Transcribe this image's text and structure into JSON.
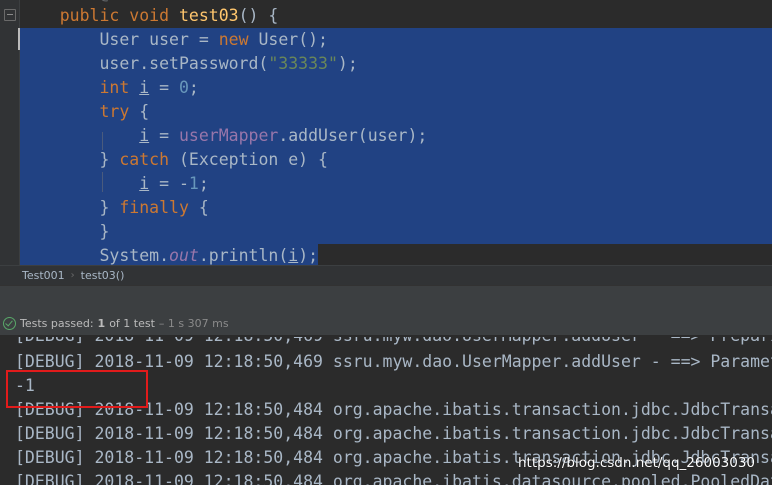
{
  "editor": {
    "lines": [
      {
        "indent": "    ",
        "kw1": "public void ",
        "fn": "test03",
        "rest": "() {"
      },
      {
        "indent": "        ",
        "t1": "User user = ",
        "kw": "new ",
        "t2": "User();"
      },
      {
        "indent": "        ",
        "t1": "user.setPassword(",
        "str": "\"33333\"",
        "t2": ");"
      },
      {
        "indent": "        ",
        "kw": "int ",
        "var": "i",
        "t1": " = ",
        "num": "0",
        "t2": ";"
      },
      {
        "indent": "        ",
        "kw": "try ",
        "t1": "{"
      },
      {
        "indent": "            ",
        "var": "i",
        "t1": " = ",
        "fld": "userMapper",
        "t2": ".addUser(user);"
      },
      {
        "indent": "        ",
        "t1": "} ",
        "kw": "catch ",
        "t2": "(Exception e) {"
      },
      {
        "indent": "            ",
        "var": "i",
        "t1": " = -",
        "num": "1",
        "t2": ";"
      },
      {
        "indent": "        ",
        "t1": "} ",
        "kw": "finally ",
        "t2": "{"
      },
      {
        "indent": "        ",
        "t1": "}"
      },
      {
        "indent": "        ",
        "t1": "System.",
        "it": "out",
        "t2": ".println(",
        "var": "i",
        "t3": ");"
      }
    ]
  },
  "breadcrumb": {
    "class": "Test001",
    "method": "test03()"
  },
  "status": {
    "label": "Tests passed:",
    "passed": "1",
    "of_text": "of 1 test",
    "time": "– 1 s 307 ms"
  },
  "console": {
    "lines": [
      "[DEBUG] 2018-11-09 12:18:50,469 ssru.myw.dao.UserMapper.addUser - ==> Parameters",
      "-1",
      "[DEBUG] 2018-11-09 12:18:50,484 org.apache.ibatis.transaction.jdbc.JdbcTransaction",
      "[DEBUG] 2018-11-09 12:18:50,484 org.apache.ibatis.transaction.jdbc.JdbcTransaction",
      "[DEBUG] 2018-11-09 12:18:50,484 org.apache.ibatis.transaction.jdbc.JdbcTransaction",
      "[DEBUG] 2018-11-09 12:18:50,484 org.apache.ibatis.datasource.pooled.PooledDataSource"
    ],
    "partial_top": "[DEBUG] 2018-11-09 12:18:50,469 ssru.myw.dao.UserMapper.addUser - ==> Preparing"
  },
  "watermark": "https://blog.csdn.net/qq_26003030",
  "colors": {
    "selection": "#214283",
    "keyword": "#cc7832",
    "method": "#ffc66d",
    "string": "#6a8759",
    "number": "#6897bb",
    "field": "#9876aa",
    "highlight_box": "#e11b1b",
    "pass_green": "#59a869"
  }
}
